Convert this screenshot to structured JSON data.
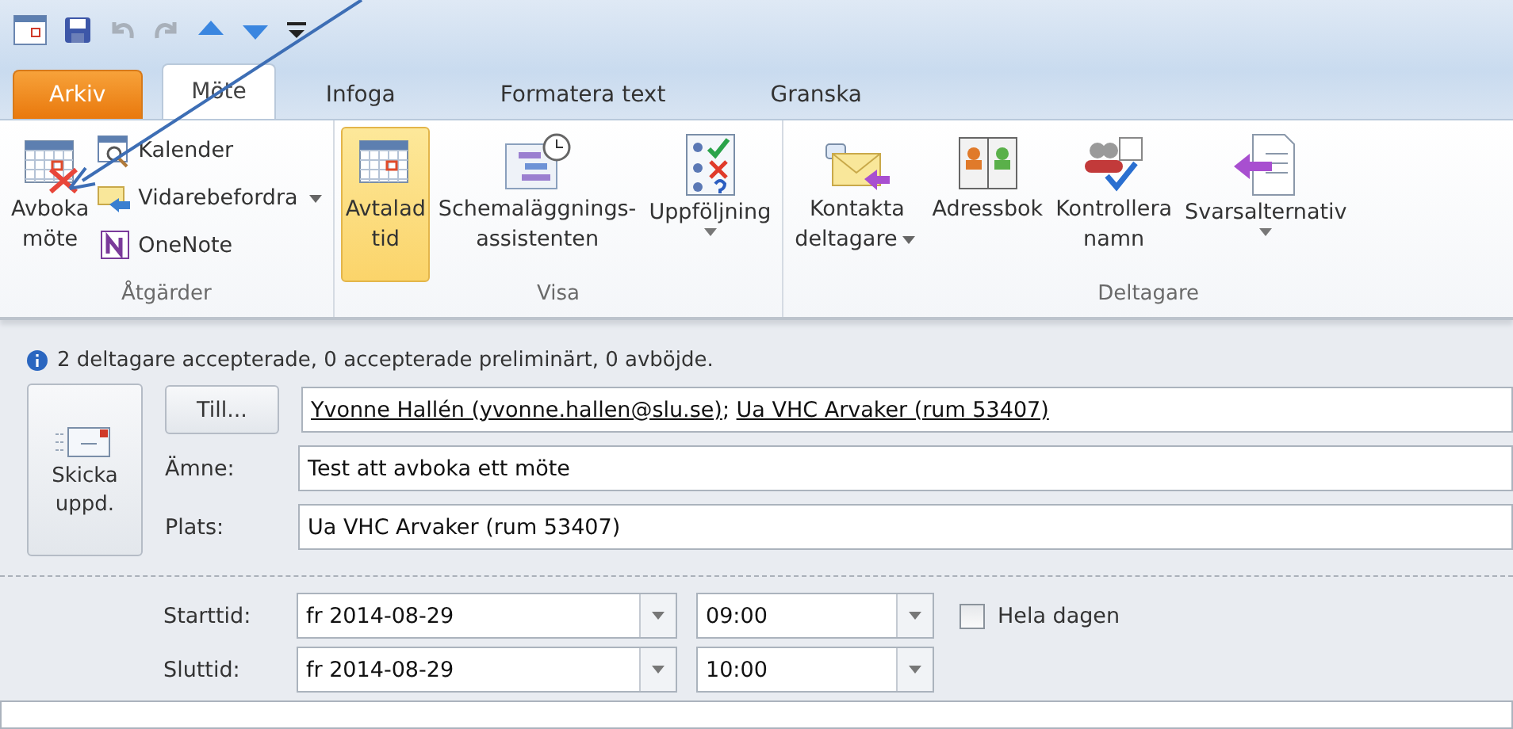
{
  "tabs": [
    {
      "label": "Arkiv",
      "kind": "file",
      "selected": false
    },
    {
      "label": "Möte",
      "kind": "tab",
      "selected": true
    },
    {
      "label": "Infoga",
      "kind": "tab",
      "selected": false
    },
    {
      "label": "Formatera text",
      "kind": "tab",
      "selected": false
    },
    {
      "label": "Granska",
      "kind": "tab",
      "selected": false
    }
  ],
  "ribbon": {
    "groups": [
      {
        "label": "Åtgärder",
        "large": [
          {
            "lines": [
              "Avboka",
              "möte"
            ],
            "selected": false,
            "dropdown": false
          }
        ],
        "small": [
          {
            "label": "Kalender",
            "dropdown": false
          },
          {
            "label": "Vidarebefordra",
            "dropdown": true
          },
          {
            "label": "OneNote",
            "dropdown": false
          }
        ]
      },
      {
        "label": "Visa",
        "large": [
          {
            "lines": [
              "Avtalad",
              "tid"
            ],
            "selected": true,
            "dropdown": false
          },
          {
            "lines": [
              "Schemaläggnings-",
              "assistenten"
            ],
            "selected": false,
            "dropdown": false
          },
          {
            "lines": [
              "Uppföljning"
            ],
            "selected": false,
            "dropdown": true
          }
        ]
      },
      {
        "label": "Deltagare",
        "large": [
          {
            "lines": [
              "Kontakta",
              "deltagare"
            ],
            "selected": false,
            "dropdown": true
          },
          {
            "lines": [
              "Adressbok"
            ],
            "selected": false,
            "dropdown": false
          },
          {
            "lines": [
              "Kontrollera",
              "namn"
            ],
            "selected": false,
            "dropdown": false
          },
          {
            "lines": [
              "Svarsalternativ"
            ],
            "selected": false,
            "dropdown": true
          }
        ]
      }
    ]
  },
  "info": "2 deltagare accepterade, 0 accepterade preliminärt, 0 avböjde.",
  "send_button": [
    "Skicka",
    "uppd."
  ],
  "to_button": "Till...",
  "recipients": [
    "Yvonne Hallén (yvonne.hallen@slu.se)",
    "Ua VHC Arvaker (rum 53407)"
  ],
  "separator": ";",
  "fields": [
    {
      "label": "Ämne:",
      "value": "Test att avboka ett möte"
    },
    {
      "label": "Plats:",
      "value": "Ua VHC Arvaker (rum 53407)"
    }
  ],
  "times": [
    {
      "label": "Starttid:",
      "date": "fr 2014-08-29",
      "time": "09:00"
    },
    {
      "label": "Sluttid:",
      "date": "fr 2014-08-29",
      "time": "10:00"
    }
  ],
  "all_day": {
    "label": "Hela dagen",
    "checked": false
  }
}
